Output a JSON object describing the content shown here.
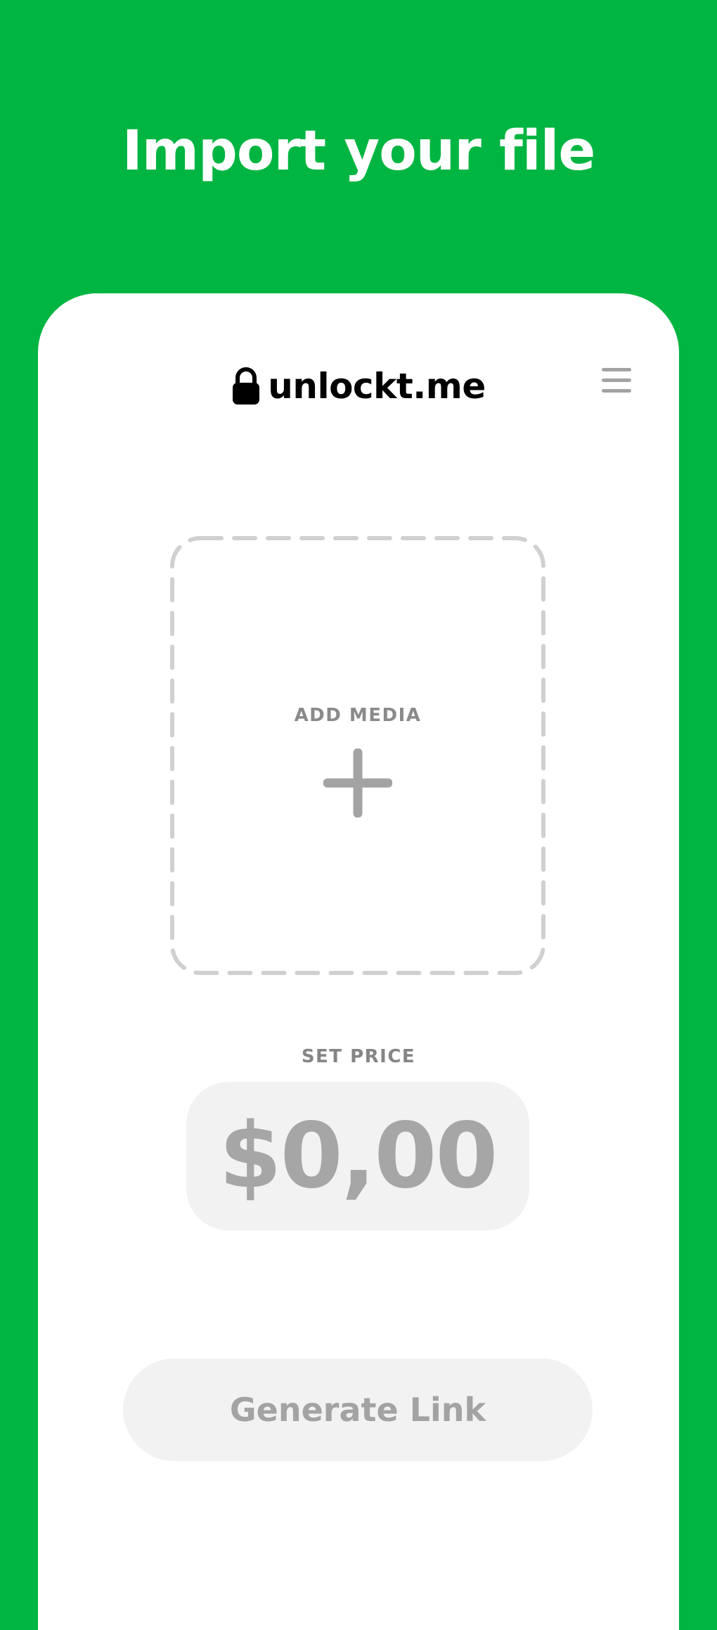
{
  "header": {
    "title": "Import your file"
  },
  "brand": {
    "name": "unlockt.me",
    "icon": "lock-icon"
  },
  "menu": {
    "icon": "hamburger-menu-icon"
  },
  "upload": {
    "label": "ADD MEDIA",
    "icon": "plus-icon"
  },
  "price": {
    "label": "SET PRICE",
    "value": "$0,00"
  },
  "actions": {
    "generate_label": "Generate Link"
  },
  "colors": {
    "background": "#00b541",
    "card": "#ffffff",
    "muted_text": "#8a8a8a",
    "disabled_fill": "#f2f2f2",
    "dash_border": "#d0d0d0"
  }
}
